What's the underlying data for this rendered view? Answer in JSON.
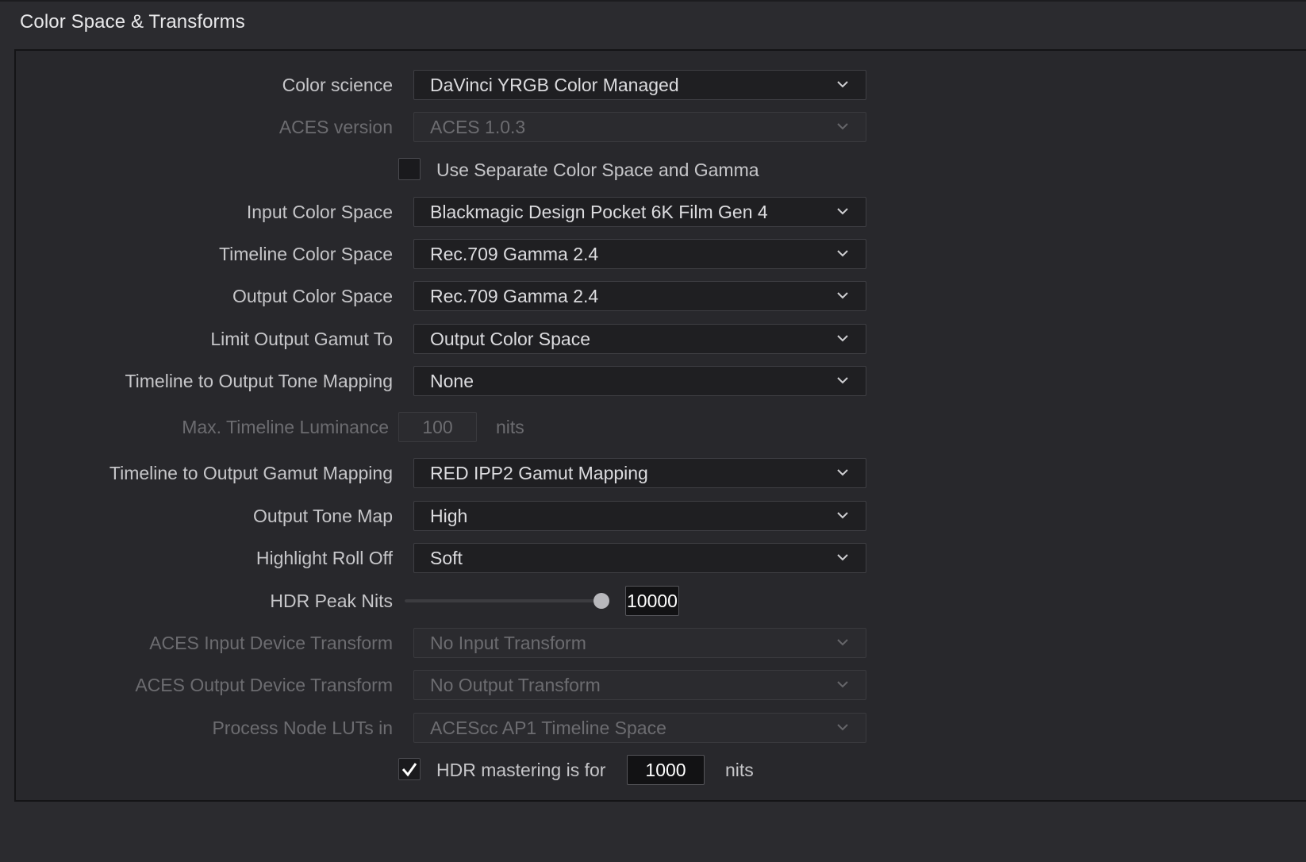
{
  "section": {
    "title": "Color Space & Transforms"
  },
  "rows": {
    "color_science": {
      "label": "Color science",
      "value": "DaVinci YRGB Color Managed"
    },
    "aces_version": {
      "label": "ACES version",
      "value": "ACES 1.0.3"
    },
    "separate_cs_gamma": {
      "label": "Use Separate Color Space and Gamma",
      "checked": false
    },
    "input_cs": {
      "label": "Input Color Space",
      "value": "Blackmagic Design Pocket 6K Film Gen 4"
    },
    "timeline_cs": {
      "label": "Timeline Color Space",
      "value": "Rec.709 Gamma 2.4"
    },
    "output_cs": {
      "label": "Output Color Space",
      "value": "Rec.709 Gamma 2.4"
    },
    "limit_gamut": {
      "label": "Limit Output Gamut To",
      "value": "Output Color Space"
    },
    "tone_mapping": {
      "label": "Timeline to Output Tone Mapping",
      "value": "None"
    },
    "max_luminance": {
      "label": "Max. Timeline Luminance",
      "value": "100",
      "unit": "nits"
    },
    "gamut_mapping": {
      "label": "Timeline to Output Gamut Mapping",
      "value": "RED IPP2 Gamut Mapping"
    },
    "output_tone_map": {
      "label": "Output Tone Map",
      "value": "High"
    },
    "highlight_rolloff": {
      "label": "Highlight Roll Off",
      "value": "Soft"
    },
    "hdr_peak_nits": {
      "label": "HDR Peak Nits",
      "value": "10000",
      "slider_fraction": 1.0
    },
    "aces_idt": {
      "label": "ACES Input Device Transform",
      "value": "No Input Transform"
    },
    "aces_odt": {
      "label": "ACES Output Device Transform",
      "value": "No Output Transform"
    },
    "process_luts": {
      "label": "Process Node LUTs in",
      "value": "ACEScc AP1 Timeline Space"
    },
    "hdr_mastering": {
      "label": "HDR mastering is for",
      "value": "1000",
      "unit": "nits",
      "checked": true
    }
  },
  "icons": {
    "dropdown": "chevron-down-icon",
    "check": "checkmark-icon"
  },
  "colors": {
    "background": "#2b2b2f",
    "field": "#1f1f22",
    "text": "#c6c6c9",
    "disabled_text": "#6c6c70"
  }
}
